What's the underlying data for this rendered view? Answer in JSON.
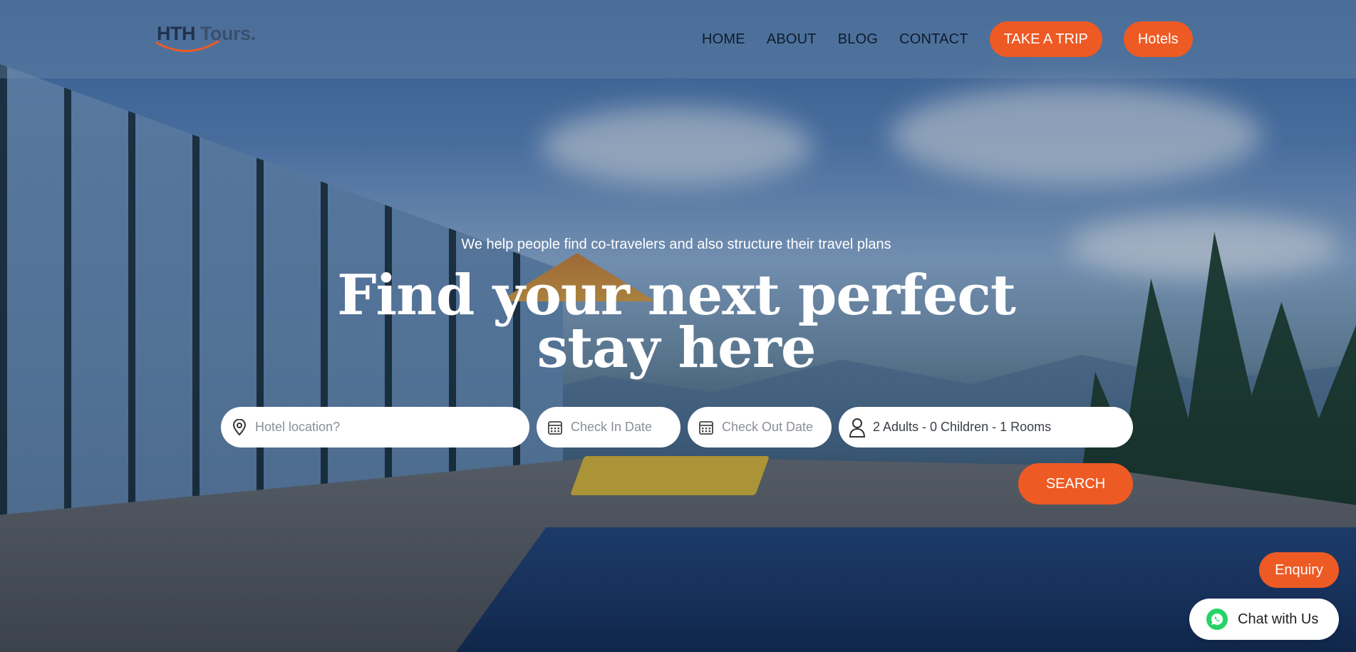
{
  "header": {
    "logo": {
      "brand": "HTH",
      "suffix": "Tours."
    },
    "nav": [
      {
        "label": "HOME"
      },
      {
        "label": "ABOUT"
      },
      {
        "label": "BLOG"
      },
      {
        "label": "CONTACT"
      }
    ],
    "take_trip_label": "TAKE A TRIP",
    "hotels_label": "Hotels"
  },
  "hero": {
    "tagline": "We help people find co-travelers and also structure their travel plans",
    "headline_line1": "Find your next perfect",
    "headline_line2": "stay here"
  },
  "search": {
    "location_placeholder": "Hotel location?",
    "checkin_placeholder": "Check In Date",
    "checkout_placeholder": "Check Out Date",
    "guests_value": "2 Adults - 0 Children - 1 Rooms",
    "search_label": "SEARCH",
    "icons": [
      "map-pin-icon",
      "calendar-icon",
      "calendar-icon",
      "user-icon"
    ]
  },
  "widgets": {
    "enquiry_label": "Enquiry",
    "chat_label": "Chat with Us",
    "chat_icon": "whatsapp-icon"
  },
  "colors": {
    "accent": "#ee5a24",
    "nav_text": "#0f1b2b",
    "field_bg": "#ffffff"
  }
}
